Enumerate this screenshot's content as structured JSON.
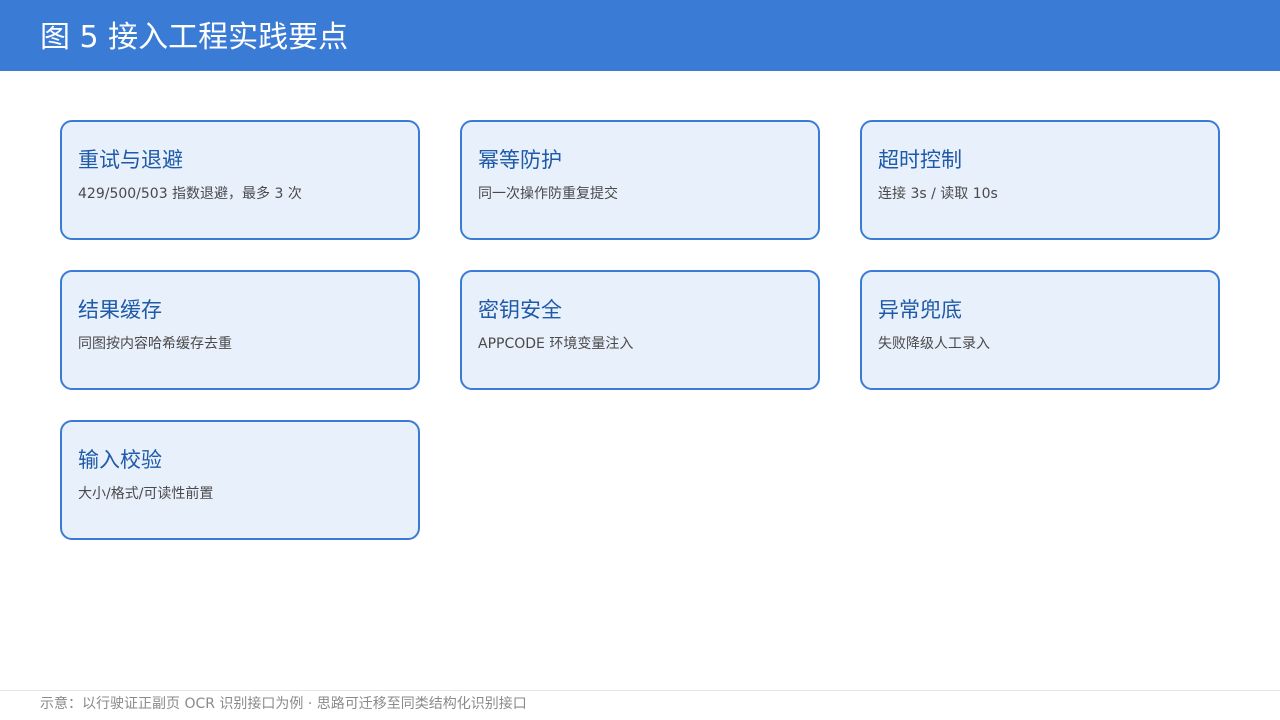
{
  "header": {
    "title": "图 5  接入工程实践要点"
  },
  "cards": [
    {
      "title": "重试与退避",
      "desc": "429/500/503 指数退避，最多 3 次"
    },
    {
      "title": "幂等防护",
      "desc": "同一次操作防重复提交"
    },
    {
      "title": "超时控制",
      "desc": "连接 3s / 读取 10s"
    },
    {
      "title": "结果缓存",
      "desc": "同图按内容哈希缓存去重"
    },
    {
      "title": "密钥安全",
      "desc": "APPCODE 环境变量注入"
    },
    {
      "title": "异常兜底",
      "desc": "失败降级人工录入"
    },
    {
      "title": "输入校验",
      "desc": "大小/格式/可读性前置"
    }
  ],
  "footer": {
    "note": "示意：以行驶证正副页 OCR 识别接口为例 · 思路可迁移至同类结构化识别接口"
  },
  "colors": {
    "header_bg": "#3a7bd5",
    "card_bg": "#e8f0fb",
    "card_border": "#3a7bd5",
    "card_title": "#1e5aa8",
    "card_desc": "#4a4a4a",
    "footer_text": "#8a8a8a"
  }
}
